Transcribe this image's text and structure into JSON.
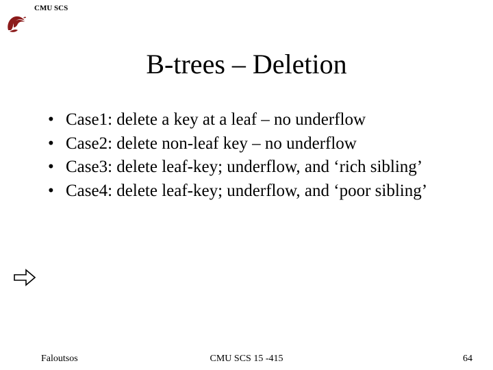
{
  "header": {
    "label": "CMU SCS"
  },
  "title": "B-trees – Deletion",
  "bullets": [
    "Case1: delete a key at a leaf – no underflow",
    "Case2: delete non-leaf key – no underflow",
    "Case3: delete leaf-key; underflow, and ‘rich sibling’",
    "Case4: delete leaf-key; underflow, and ‘poor sibling’"
  ],
  "footer": {
    "author": "Faloutsos",
    "course": "CMU SCS 15 -415",
    "page": "64"
  },
  "colors": {
    "logo": "#8b1a1a"
  }
}
